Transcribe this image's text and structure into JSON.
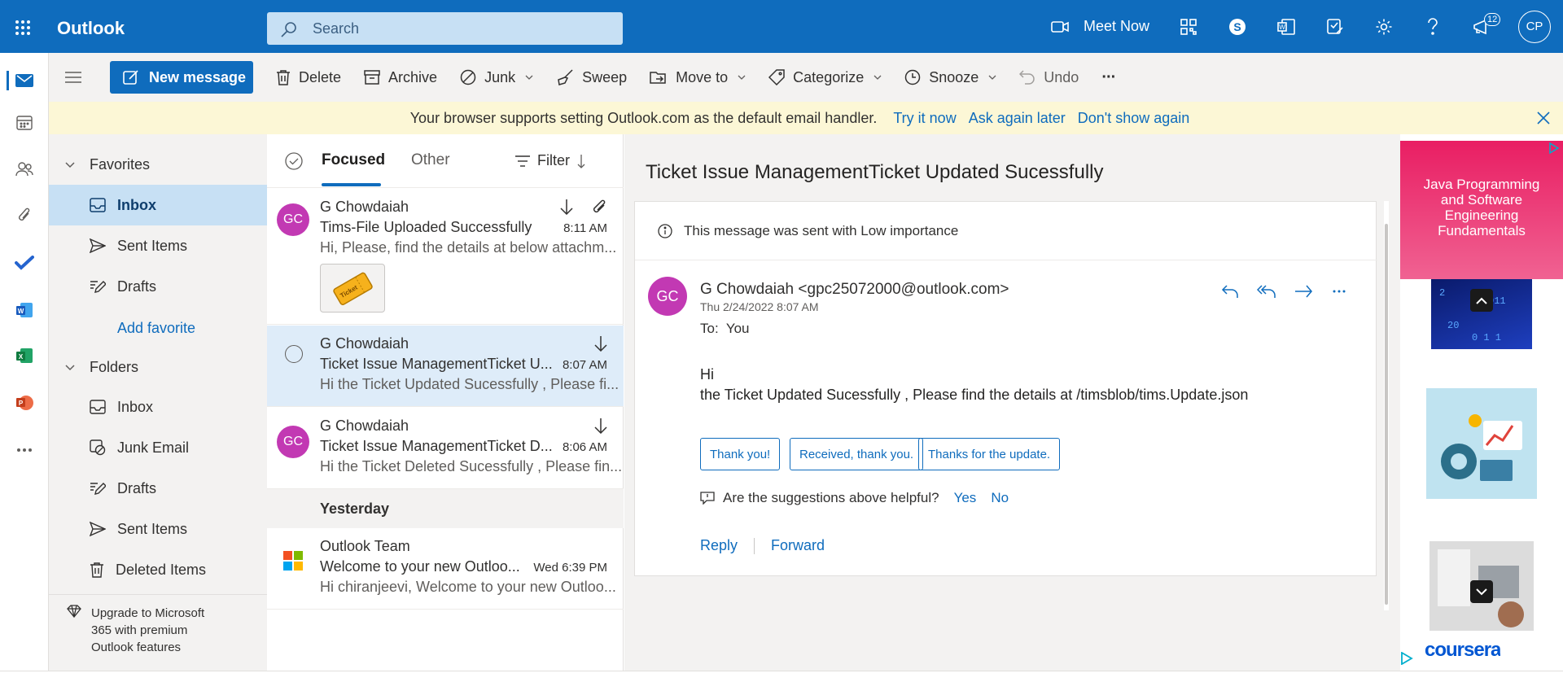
{
  "app": {
    "title": "Outlook"
  },
  "search": {
    "placeholder": "Search"
  },
  "top_actions": {
    "meet_now": "Meet Now",
    "notifications_count": "12",
    "avatar": "CP"
  },
  "toolbar": {
    "new_message": "New message",
    "delete": "Delete",
    "archive": "Archive",
    "junk": "Junk",
    "sweep": "Sweep",
    "move_to": "Move to",
    "categorize": "Categorize",
    "snooze": "Snooze",
    "undo": "Undo",
    "more": "···"
  },
  "banner": {
    "message": "Your browser supports setting Outlook.com as the default email handler.",
    "try_it_now": "Try it now",
    "ask_again_later": "Ask again later",
    "dont_show_again": "Don't show again"
  },
  "nav": {
    "favorites_label": "Favorites",
    "favorites": [
      {
        "label": "Inbox",
        "icon": "inbox-icon"
      },
      {
        "label": "Sent Items",
        "icon": "send-icon"
      },
      {
        "label": "Drafts",
        "icon": "draft-icon"
      }
    ],
    "add_favorite": "Add favorite",
    "folders_label": "Folders",
    "folders": [
      {
        "label": "Inbox",
        "icon": "inbox-icon"
      },
      {
        "label": "Junk Email",
        "icon": "junk-icon"
      },
      {
        "label": "Drafts",
        "icon": "draft-icon"
      },
      {
        "label": "Sent Items",
        "icon": "send-icon"
      },
      {
        "label": "Deleted Items",
        "icon": "trash-icon"
      }
    ],
    "upgrade_line1": "Upgrade to Microsoft",
    "upgrade_line2": "365 with premium",
    "upgrade_line3": "Outlook features"
  },
  "list": {
    "tab_focused": "Focused",
    "tab_other": "Other",
    "filter": "Filter",
    "messages": [
      {
        "avatar": "GC",
        "from": "G Chowdaiah",
        "subject": "Tims-File Uploaded Successfully",
        "time": "8:11 AM",
        "preview": "Hi, Please, find the details at below attachm..."
      },
      {
        "avatar": "GC",
        "from": "G Chowdaiah",
        "subject": "Ticket Issue ManagementTicket U...",
        "time": "8:07 AM",
        "preview": "Hi the Ticket Updated Sucessfully , Please fi..."
      },
      {
        "avatar": "GC",
        "from": "G Chowdaiah",
        "subject": "Ticket Issue ManagementTicket D...",
        "time": "8:06 AM",
        "preview": "Hi the Ticket Deleted Sucessfully , Please fin..."
      }
    ],
    "yesterday_label": "Yesterday",
    "older": {
      "from": "Outlook Team",
      "subject": "Welcome to your new Outloo...",
      "time": "Wed 6:39 PM",
      "preview": "Hi chiranjeevi, Welcome to your new Outloo..."
    },
    "attachment_thumb_text": "Ticket"
  },
  "reading": {
    "title": "Ticket Issue ManagementTicket Updated Sucessfully",
    "importance": "This message was sent with Low importance",
    "avatar": "GC",
    "sender": "G Chowdaiah <gpc25072000@outlook.com>",
    "date": "Thu 2/24/2022 8:07 AM",
    "to_label": "To:",
    "to_value": "You",
    "body_line1": "Hi",
    "body_line2": "the Ticket Updated Sucessfully , Please find the details at /timsblob/tims.Update.json",
    "suggestions": [
      "Thank you!",
      "Received, thank you.",
      "Thanks for the update."
    ],
    "helpful_q": "Are the suggestions above helpful?",
    "helpful_yes": "Yes",
    "helpful_no": "No",
    "reply": "Reply",
    "forward": "Forward"
  },
  "ad": {
    "title_line1": "Java Programming",
    "title_line2": "and Software",
    "title_line3": "Engineering",
    "title_line4": "Fundamentals",
    "brand": "coursera"
  },
  "colors": {
    "brand": "#0f6cbd",
    "avatar": "#c239b3",
    "banner": "#fcf7d6",
    "selected": "#c7e0f4"
  }
}
